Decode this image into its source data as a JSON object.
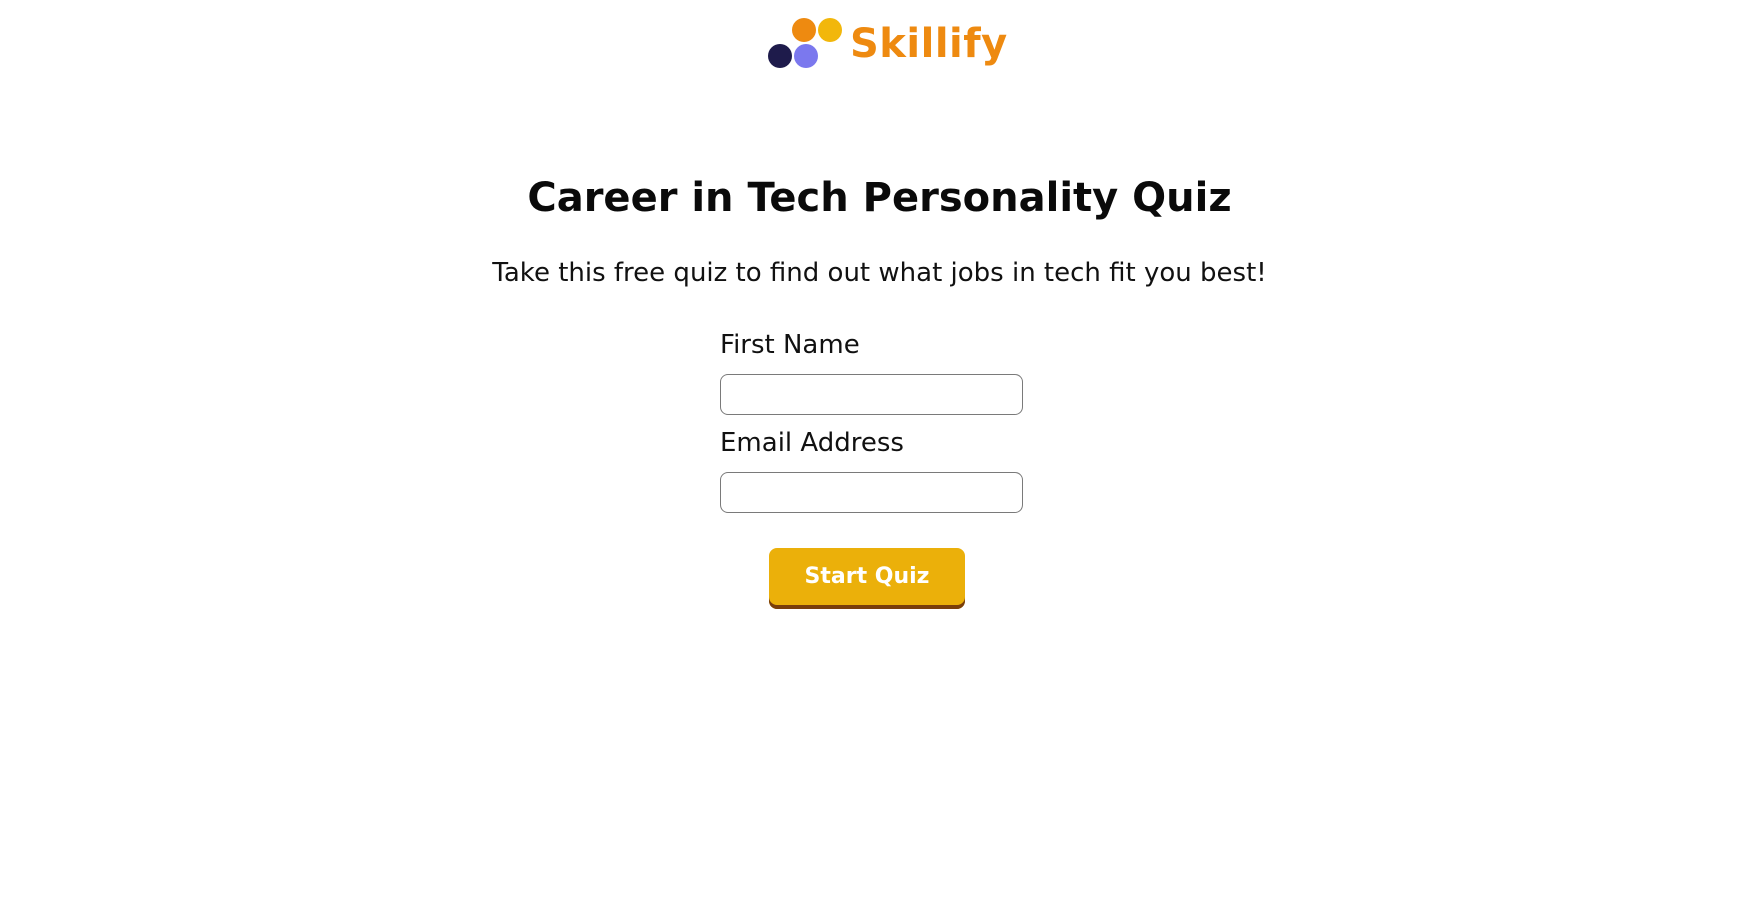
{
  "brand": {
    "name": "Skillify",
    "logo_icon": "four-dots-logo-icon",
    "text_color": "#EE8A10",
    "dot_colors": [
      "#EE8A10",
      "#F2B70B",
      "#1E1B4B",
      "#7B78EE"
    ]
  },
  "hero": {
    "title": "Career in Tech Personality Quiz",
    "subtitle": "Take this free quiz to find out what jobs in tech fit you best!"
  },
  "form": {
    "first_name": {
      "label": "First Name",
      "value": "",
      "placeholder": ""
    },
    "email": {
      "label": "Email Address",
      "value": "",
      "placeholder": ""
    },
    "submit": {
      "label": "Start Quiz",
      "color": "#EBB00A",
      "shadow_color": "#7A3E0A"
    }
  }
}
